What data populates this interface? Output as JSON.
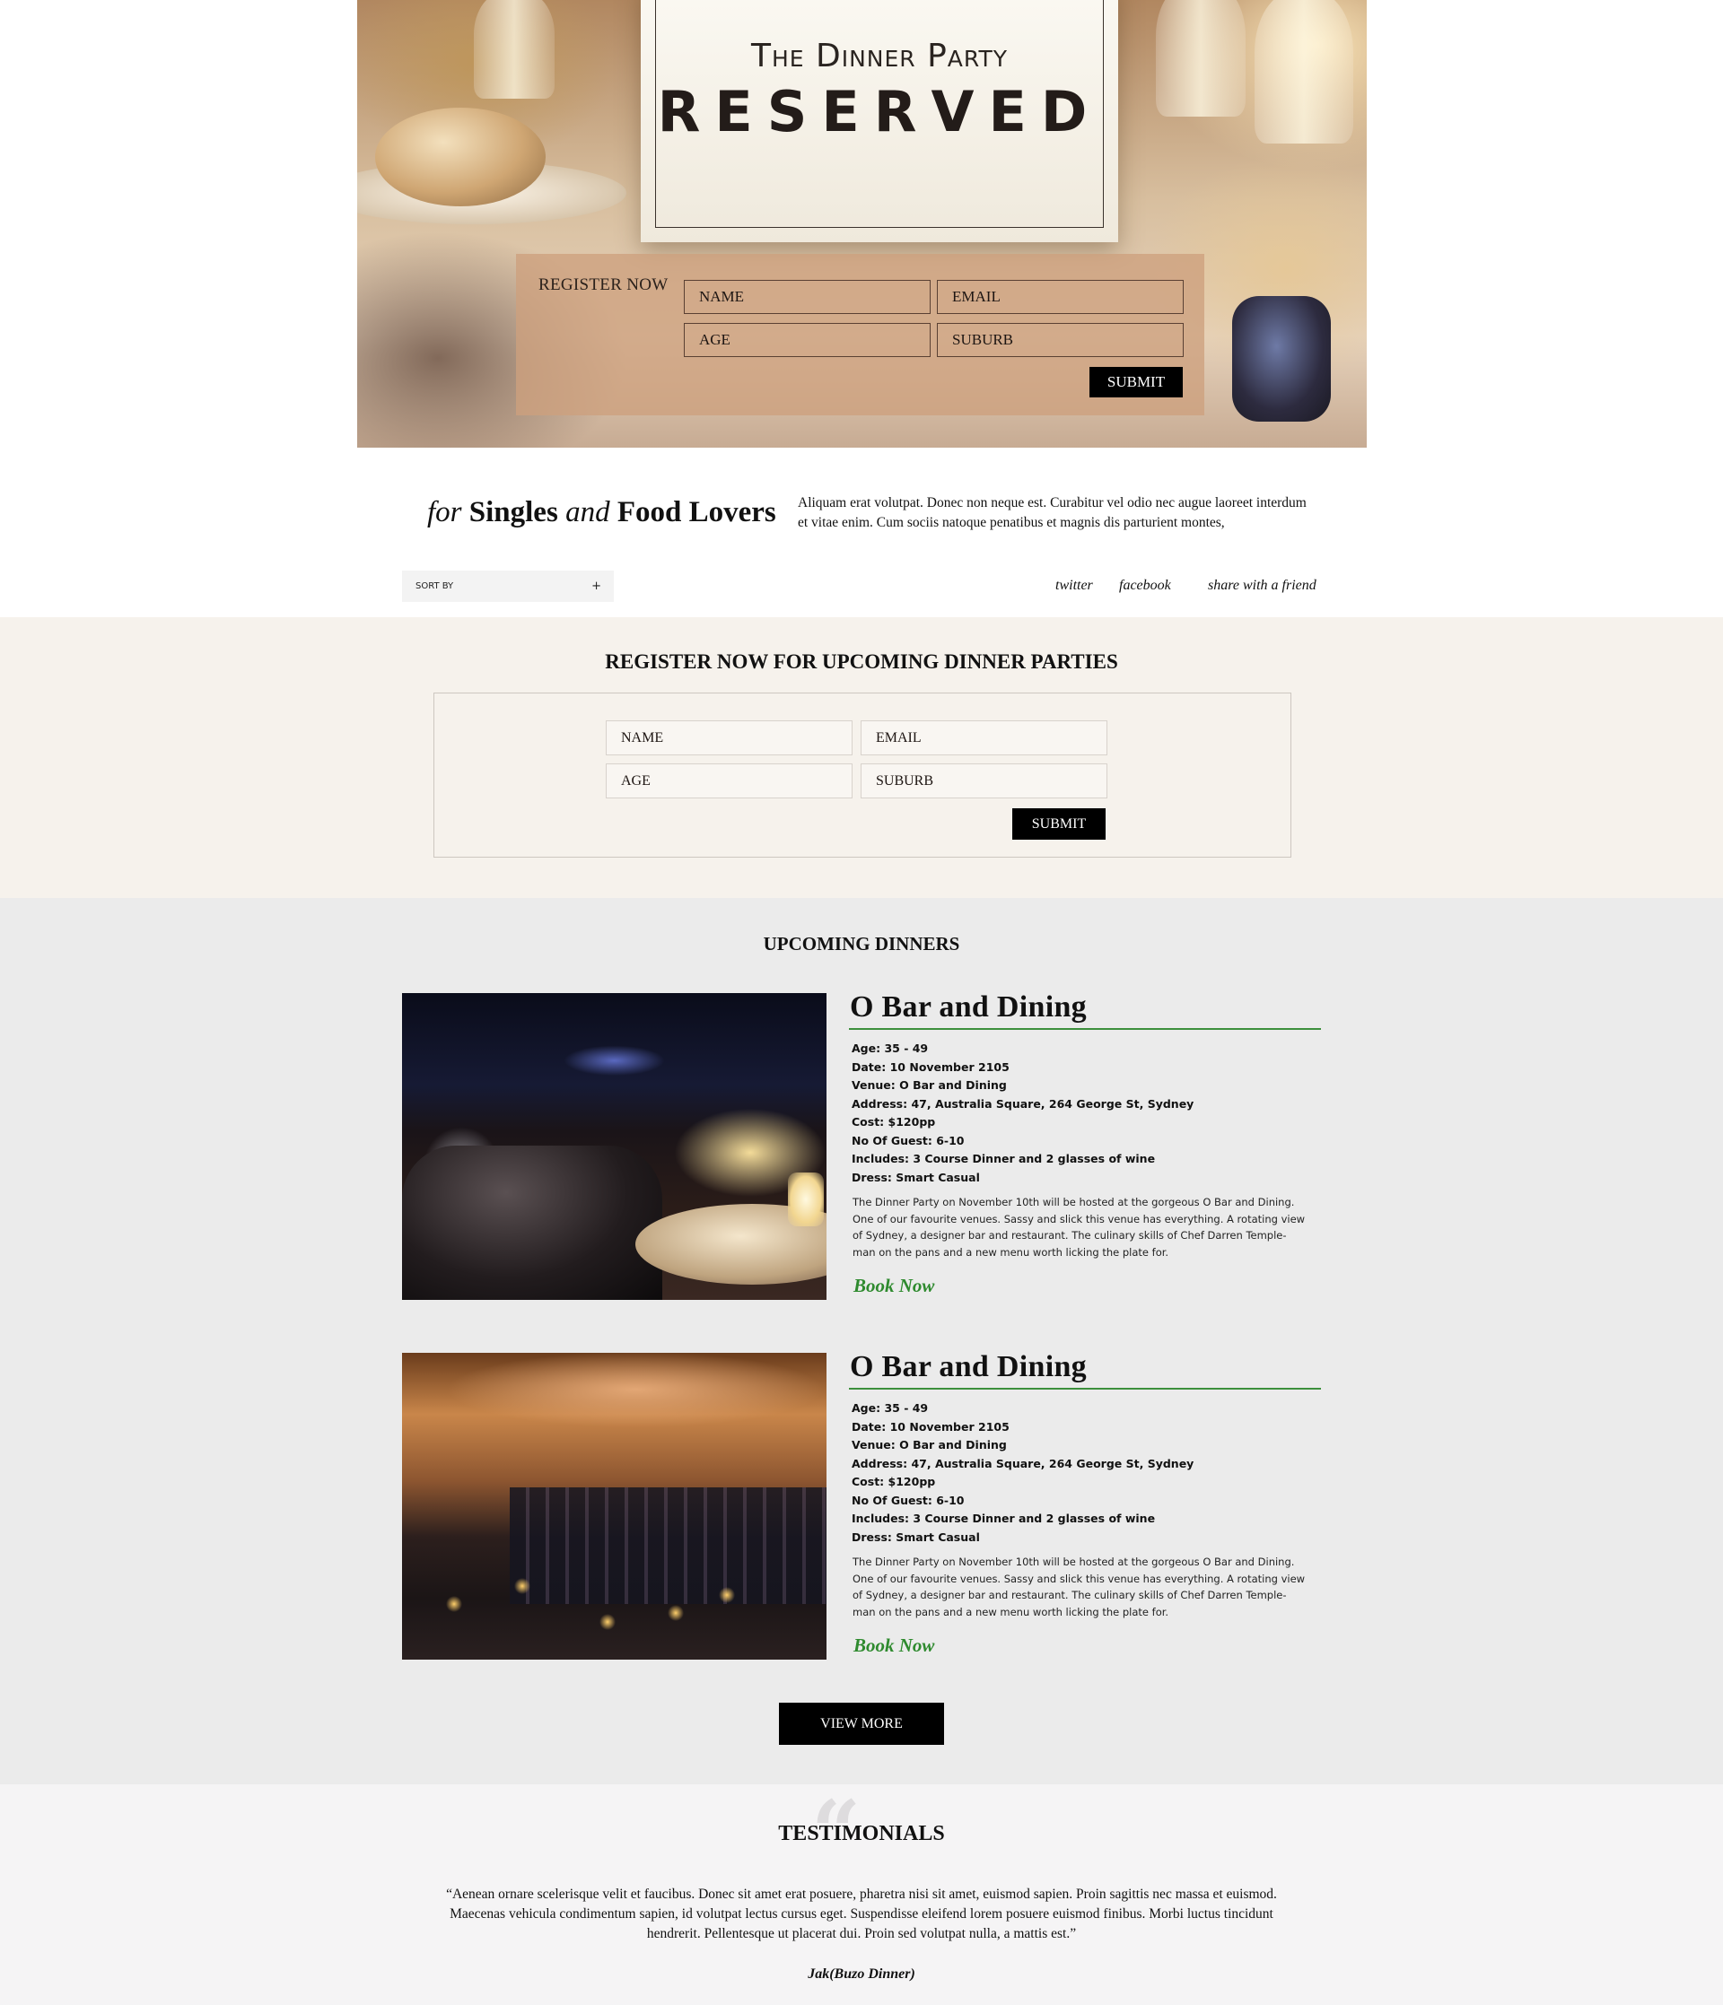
{
  "hero": {
    "brand": "The Dinner Party",
    "card_title": "RESERVED",
    "form": {
      "label": "REGISTER NOW",
      "name": "NAME",
      "email": "EMAIL",
      "age": "AGE",
      "suburb": "SUBURB",
      "submit": "SUBMIT"
    }
  },
  "tagline": {
    "for": "for",
    "singles": "Singles",
    "and": "and",
    "food_lovers": "Food Lovers"
  },
  "intro": "Aliquam erat volutpat. Donec non neque est. Curabitur vel odio nec augue laoreet interdum et vitae enim. Cum sociis natoque penatibus et magnis dis parturient montes,",
  "sort": {
    "label": "SORT BY",
    "icon": "+"
  },
  "social": {
    "twitter": "twitter",
    "facebook": "facebook",
    "share": "share with a friend"
  },
  "register": {
    "title": "REGISTER NOW FOR UPCOMING DINNER PARTIES",
    "name": "NAME",
    "email": "EMAIL",
    "age": "AGE",
    "suburb": "SUBURB",
    "submit": "SUBMIT"
  },
  "upcoming": {
    "title": "UPCOMING DINNERS",
    "dinners": [
      {
        "title": "O Bar and Dining",
        "facts": [
          "Age: 35 - 49",
          "Date: 10 November 2105",
          "Venue: O Bar and Dining",
          "Address: 47, Australia Square, 264 George St, Sydney",
          "Cost: $120pp",
          "No Of Guest: 6-10",
          "Includes: 3 Course Dinner and 2 glasses of wine",
          "Dress: Smart Casual"
        ],
        "description": "The Dinner Party on November 10th will be hosted at the gorgeous O Bar and Dining. One of our favourite venues. Sassy and slick this venue has everything. A rotating view of Sydney, a designer bar and restaurant. The culinary skills of Chef Darren Temple-man on the pans and a new menu worth licking the plate for.",
        "book": "Book Now"
      },
      {
        "title": "O Bar and Dining",
        "facts": [
          "Age: 35 - 49",
          "Date: 10 November 2105",
          "Venue: O Bar and Dining",
          "Address: 47, Australia Square, 264 George St, Sydney",
          "Cost: $120pp",
          "No Of Guest: 6-10",
          "Includes: 3 Course Dinner and 2 glasses of wine",
          "Dress: Smart Casual"
        ],
        "description": "The Dinner Party on November 10th will be hosted at the gorgeous O Bar and Dining. One of our favourite venues. Sassy and slick this venue has everything. A rotating view of Sydney, a designer bar and restaurant. The culinary skills of Chef Darren Temple-man on the pans and a new menu worth licking the plate for.",
        "book": "Book Now"
      }
    ],
    "view_more": "VIEW MORE"
  },
  "testimonials": {
    "title": "TESTIMONIALS",
    "quote": "“Aenean ornare scelerisque velit et faucibus. Donec sit amet erat posuere, pharetra nisi sit amet, euismod sapien. Proin sagittis nec massa et euismod. Maecenas vehicula condimentum sapien, id volutpat lectus cursus eget. Suspendisse eleifend lorem posuere euismod finibus. Morbi luctus tincidunt hendrerit. Pellentesque ut placerat dui. Proin sed volutpat nulla, a mattis est.”",
    "author": "Jak(Buzo Dinner)"
  },
  "colors": {
    "accent_green": "#2e8a2e",
    "register_band": "#f6f2ec",
    "upcoming_band": "#ebebeb",
    "button": "#000000"
  }
}
